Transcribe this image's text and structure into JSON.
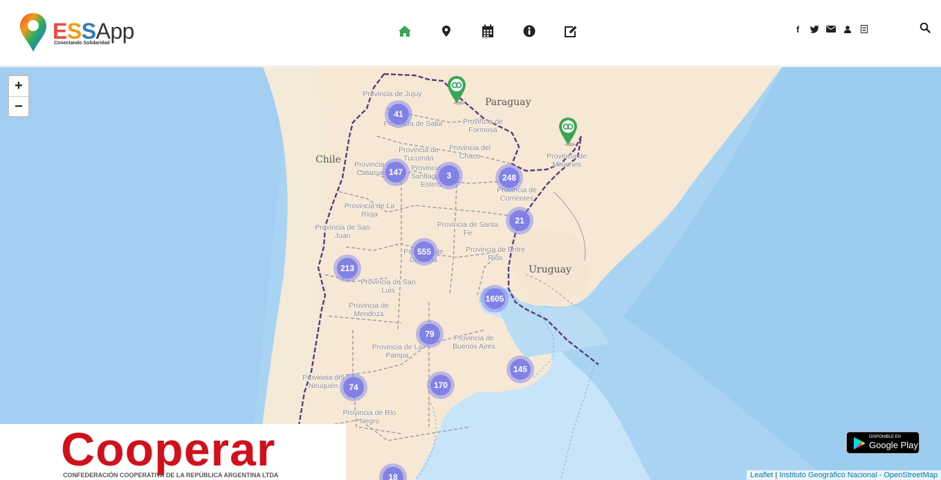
{
  "header": {
    "logo": {
      "main": "ESSApp",
      "tagline": "Conectando Solidaridad"
    },
    "nav": [
      {
        "name": "home",
        "icon": "home-icon",
        "color": "#3aa655"
      },
      {
        "name": "map",
        "icon": "map-marker-icon",
        "color": "#222222"
      },
      {
        "name": "calendar",
        "icon": "calendar-icon",
        "color": "#222222"
      },
      {
        "name": "info",
        "icon": "info-circle-icon",
        "color": "#222222"
      },
      {
        "name": "edit",
        "icon": "edit-icon",
        "color": "#222222"
      }
    ],
    "social": [
      {
        "icon": "facebook-icon",
        "glyph": "f"
      },
      {
        "icon": "twitter-icon",
        "glyph": "🐦"
      },
      {
        "icon": "envelope-icon",
        "glyph": "✉"
      },
      {
        "icon": "user-icon",
        "glyph": "👤"
      },
      {
        "icon": "document-icon",
        "glyph": "▤"
      }
    ],
    "search_icon": "search-icon"
  },
  "map": {
    "zoom_in": "+",
    "zoom_out": "−",
    "countries": [
      {
        "id": "paraguay",
        "label": "Paraguay"
      },
      {
        "id": "chile",
        "label": "Chile"
      },
      {
        "id": "uruguay",
        "label": "Uruguay"
      }
    ],
    "provinces": [
      "Provincia de Jujuy",
      "Provincia de Salta",
      "Provincia de Formosa",
      "Provincia del Chaco",
      "Provincia de Tucumán",
      "Provincia de Catamarca",
      "Provincia de Santiago del Estero",
      "Provincia de Misiones",
      "Provincia de Corrientes",
      "Provincia de La Rioja",
      "Provincia de San Juan",
      "Provincia de Santa Fe",
      "Provincia de Córdoba",
      "Provincia de Entre Ríos",
      "Provincia de San Luis",
      "Provincia de Mendoza",
      "Provincia de La Pampa",
      "Provincia de Buenos Aires",
      "Provincia del Neuquén",
      "Provincia de Río Negro"
    ],
    "clusters": [
      "41",
      "147",
      "3",
      "248",
      "21",
      "555",
      "213",
      "1605",
      "79",
      "145",
      "170",
      "74",
      "18"
    ],
    "marker_color": "#3aa655",
    "attribution": {
      "leaflet": "Leaflet",
      "separator": " | ",
      "source": "Instituto Geográfico Nacional - OpenStreetMap"
    }
  },
  "banner": {
    "title": "Cooperar",
    "subtitle": "CONFEDERACIÓN COOPERATIVA DE LA REPÚBLICA ARGENTINA LTDA",
    "title_color": "#d0111b"
  },
  "google_play": {
    "small": "DISPONIBLE EN",
    "big": "Google Play"
  }
}
